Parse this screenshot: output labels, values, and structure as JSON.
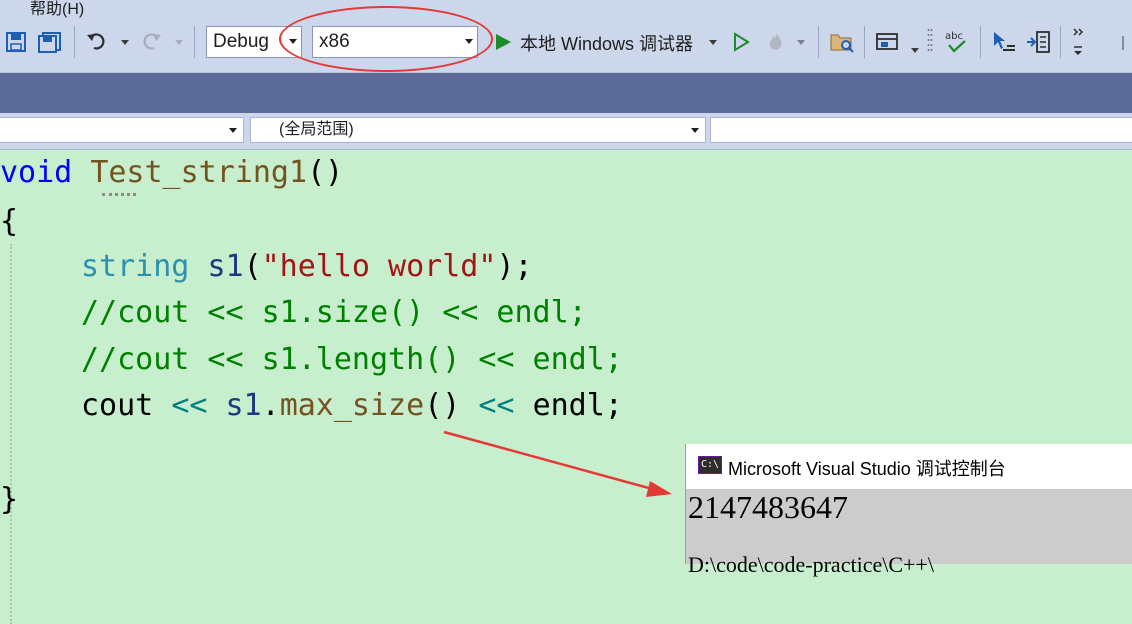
{
  "menu": {
    "help_label": "帮助(H)"
  },
  "toolbar": {
    "config_value": "Debug",
    "platform_value": "x86",
    "run_label": "本地 Windows 调试器"
  },
  "navbar": {
    "left_value": "",
    "scope_value": "(全局范围)",
    "right_value": ""
  },
  "code": {
    "line1": {
      "kw": "void",
      "fn": "Test_string1",
      "rest": "()"
    },
    "line2": "{",
    "line3": {
      "type": "string",
      "var": "s1",
      "open": "(",
      "str": "\"hello world\"",
      "close": ");"
    },
    "line4": "//cout << s1.size() << endl;",
    "line5": "//cout << s1.length() << endl;",
    "line6": {
      "cout": "cout",
      "op1": "<<",
      "var": "s1",
      "dot": ".",
      "fn": "max_size",
      "paren": "()",
      "op2": "<<",
      "endl": "endl;"
    },
    "line8": "}"
  },
  "console": {
    "title": "Microsoft Visual Studio 调试控制台",
    "icon_label": "C:\\",
    "output": "2147483647",
    "path_partial": "D:\\code\\code-practice\\C++\\"
  },
  "colors": {
    "editor_bg": "#c7eecd",
    "toolbar_bg": "#cdd7ec",
    "band_bg": "#5d6b99",
    "highlight": "#e53935",
    "keyword": "#0000ff",
    "type": "#2b91af",
    "string": "#a31515",
    "comment": "#008000"
  }
}
